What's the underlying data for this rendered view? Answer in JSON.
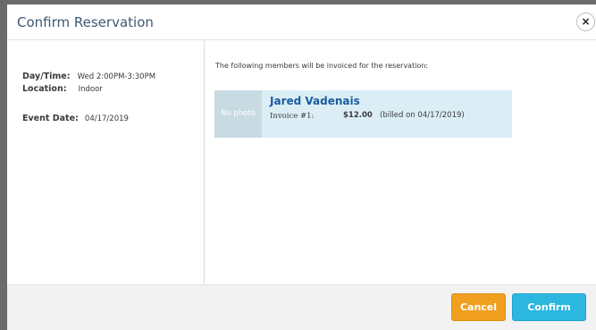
{
  "dialog": {
    "title": "Confirm Reservation",
    "close_icon": "×"
  },
  "details": {
    "day_time_label": "Day/Time:",
    "day_time_value": "Wed 2:00PM-3:30PM",
    "location_label": "Location:",
    "location_value": "Indoor",
    "event_date_label": "Event Date:",
    "event_date_value": "04/17/2019"
  },
  "invoice_section": {
    "intro": "The following members will be invoiced for the reservation:",
    "members": [
      {
        "photo_text": "No photo",
        "name": "Jared Vadenais",
        "invoice_label": "Invoice #1:",
        "amount": "$12.00",
        "billed_note": "(billed on 04/17/2019)"
      }
    ]
  },
  "footer": {
    "cancel_label": "Cancel",
    "confirm_label": "Confirm"
  },
  "colors": {
    "title": "#3f5873",
    "card_background": "#dceef5",
    "member_name": "#1a5c9e",
    "cancel_button": "#f0a01e",
    "confirm_button": "#2bb7e0"
  }
}
